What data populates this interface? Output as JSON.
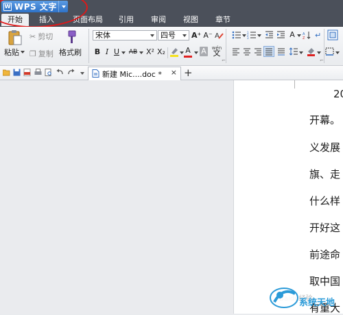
{
  "app": {
    "title": "WPS 文字",
    "logo_letter": "W"
  },
  "menu_tabs": [
    "开始",
    "插入",
    "页面布局",
    "引用",
    "审阅",
    "视图",
    "章节"
  ],
  "ribbon": {
    "paste_label": "粘贴",
    "cut_label": "剪切",
    "copy_label": "复制",
    "format_painter_label": "格式刷",
    "font_name": "宋体",
    "font_size": "四号",
    "bold": "B",
    "italic": "I",
    "underline": "U",
    "strike": "AB",
    "superscript": "X²",
    "subscript": "X₂",
    "font_color_letter": "A",
    "char_shade_letter": "A",
    "phonetic_label": "wén",
    "phonetic_char": "文",
    "grow_font": "A⁺",
    "shrink_font": "A⁻",
    "case_letter": "A"
  },
  "doc_tab": {
    "title": "新建 Mic....doc *",
    "close": "×",
    "new_tab": "+"
  },
  "document_lines": [
    "20",
    "开幕。",
    "义发展",
    "旗、走",
    "什么样",
    "开好这",
    "前途命",
    "取中国",
    "有重大"
  ],
  "watermark": {
    "text": "系统天地",
    "baidu": "Baidu经验"
  },
  "colors": {
    "titlebar": "#4b505a",
    "app_button": "#3a7fd5",
    "annotation": "#e01818",
    "font_color_bar": "#e02020",
    "highlight_bar": "#f5e11b"
  }
}
